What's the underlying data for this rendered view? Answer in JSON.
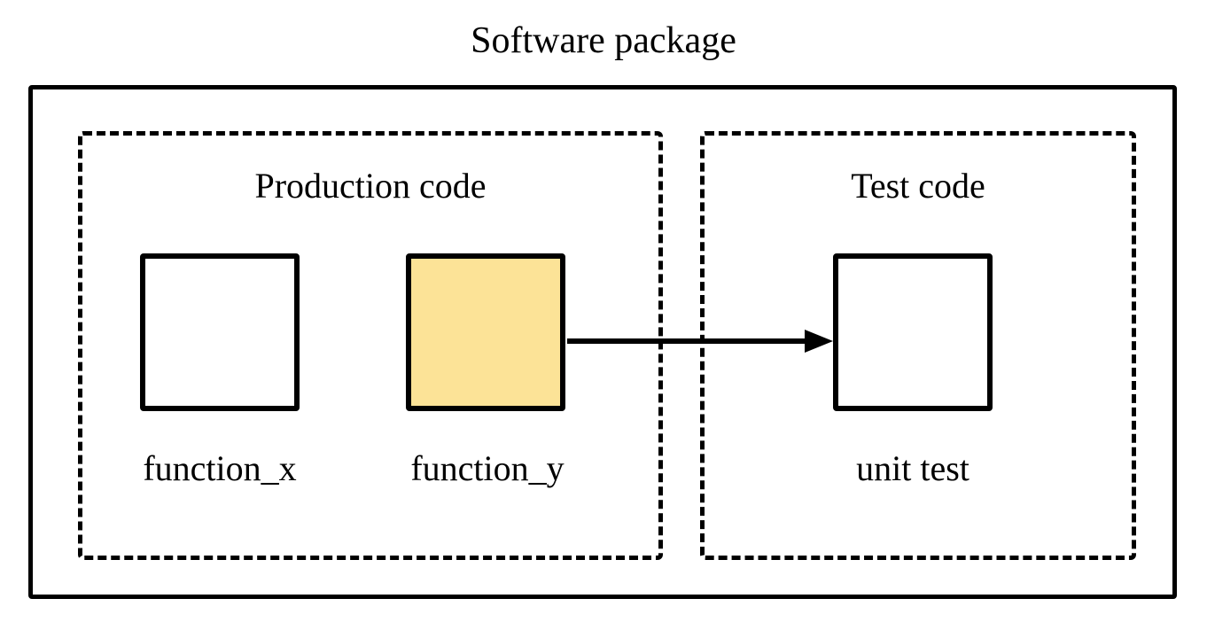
{
  "title": "Software package",
  "sections": {
    "production": {
      "title": "Production code",
      "functions": [
        {
          "name": "function_x",
          "highlighted": false
        },
        {
          "name": "function_y",
          "highlighted": true
        }
      ]
    },
    "test": {
      "title": "Test code",
      "items": [
        {
          "name": "unit test"
        }
      ]
    }
  },
  "relationships": [
    {
      "from": "function_y",
      "to": "unit test",
      "type": "tested-by"
    }
  ],
  "colors": {
    "highlight": "#fce397",
    "stroke": "#000000",
    "background": "#ffffff"
  }
}
